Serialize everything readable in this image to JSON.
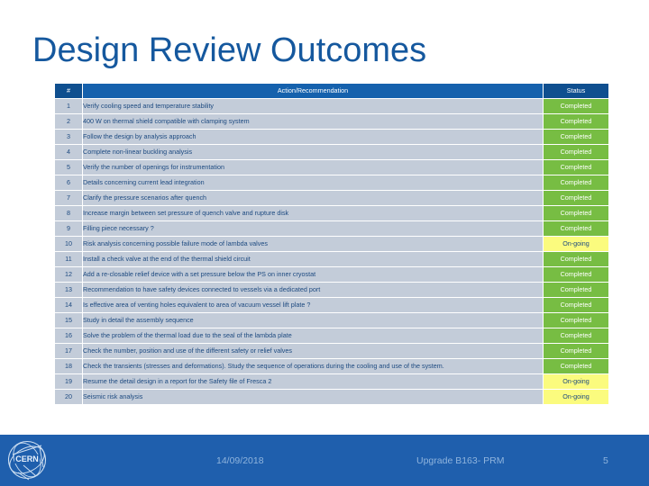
{
  "slide": {
    "title": "Design Review Outcomes",
    "title_color": "#15589e"
  },
  "table": {
    "headers": {
      "num": "#",
      "action": "Action/Recommendation",
      "status": "Status"
    },
    "header_bg": "#165a9e",
    "row_bg": "#c3ccd9",
    "row_text_color": "#1d4a80",
    "status_colors": {
      "completed_bg": "#77bd43",
      "completed_text": "#ffffff",
      "ongoing_bg": "#fbfb7e",
      "ongoing_text": "#1d4a80"
    },
    "rows": [
      {
        "num": "1",
        "action": "Verify cooling speed and temperature stability",
        "status": "Completed",
        "state": "completed"
      },
      {
        "num": "2",
        "action": "400 W on thermal shield compatible with clamping system",
        "status": "Completed",
        "state": "completed"
      },
      {
        "num": "3",
        "action": "Follow the design by analysis approach",
        "status": "Completed",
        "state": "completed"
      },
      {
        "num": "4",
        "action": "Complete non-linear buckling analysis",
        "status": "Completed",
        "state": "completed"
      },
      {
        "num": "5",
        "action": "Verify the number of openings for instrumentation",
        "status": "Completed",
        "state": "completed"
      },
      {
        "num": "6",
        "action": "Details concerning current lead integration",
        "status": "Completed",
        "state": "completed"
      },
      {
        "num": "7",
        "action": "Clarify the pressure scenarios after quench",
        "status": "Completed",
        "state": "completed"
      },
      {
        "num": "8",
        "action": "Increase margin between set pressure of quench valve and rupture disk",
        "status": "Completed",
        "state": "completed"
      },
      {
        "num": "9",
        "action": "Filling piece necessary ?",
        "status": "Completed",
        "state": "completed"
      },
      {
        "num": "10",
        "action": "Risk analysis concerning possible failure mode of lambda valves",
        "status": "On-going",
        "state": "ongoing"
      },
      {
        "num": "11",
        "action": "Install a check valve at the end of the thermal shield circuit",
        "status": "Completed",
        "state": "completed"
      },
      {
        "num": "12",
        "action": "Add a re-closable relief device with a set pressure below the PS on inner cryostat",
        "status": "Completed",
        "state": "completed"
      },
      {
        "num": "13",
        "action": "Recommendation to have safety devices connected to vessels via a dedicated port",
        "status": "Completed",
        "state": "completed"
      },
      {
        "num": "14",
        "action": "Is effective area of venting holes equivalent to area of vacuum vessel lift plate ?",
        "status": "Completed",
        "state": "completed"
      },
      {
        "num": "15",
        "action": "Study in detail the assembly sequence",
        "status": "Completed",
        "state": "completed"
      },
      {
        "num": "16",
        "action": "Solve the problem of the thermal load due to the seal of the lambda plate",
        "status": "Completed",
        "state": "completed"
      },
      {
        "num": "17",
        "action": "Check the number, position and use of the different safety or relief valves",
        "status": "Completed",
        "state": "completed"
      },
      {
        "num": "18",
        "action": "Check the transients (stresses and deformations). Study the sequence of operations during the cooling and use of the system.",
        "status": "Completed",
        "state": "completed"
      },
      {
        "num": "19",
        "action": "Resume the detail design in a report for the Safety file of Fresca 2",
        "status": "On-going",
        "state": "ongoing"
      },
      {
        "num": "20",
        "action": "Seismic risk analysis",
        "status": "On-going",
        "state": "ongoing"
      }
    ]
  },
  "footer": {
    "logo_name": "cern-logo",
    "logo_text": "CERN",
    "date": "14/09/2018",
    "subject": "Upgrade B163- PRM",
    "page_number": "5",
    "bg_color": "#1f5fad",
    "text_color": "#8fb4dd"
  }
}
